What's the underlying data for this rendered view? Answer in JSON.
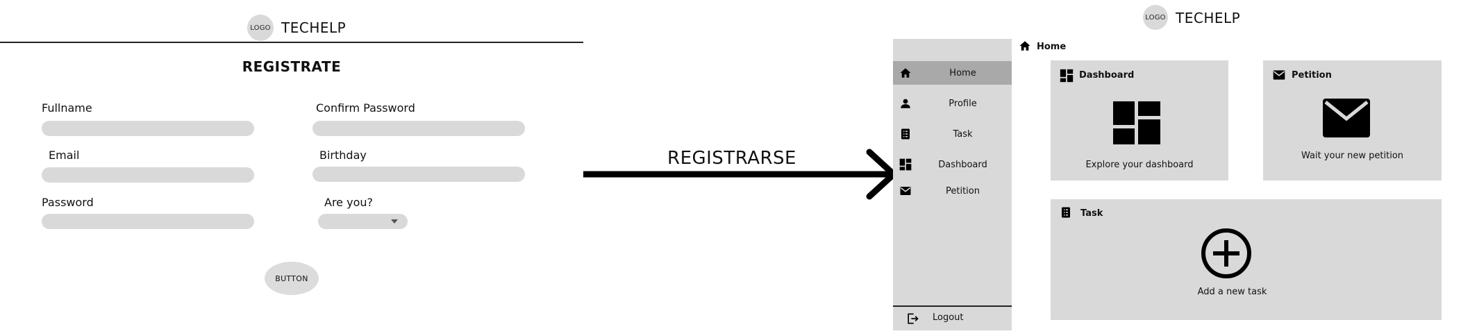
{
  "left": {
    "logo_text": "LOGO",
    "brand": "TECHELP",
    "title": "REGISTRATE",
    "fields": {
      "fullname": "Fullname",
      "confirm_password": "Confirm Password",
      "email": "Email",
      "birthday": "Birthday",
      "password": "Password",
      "are_you": "Are you?"
    },
    "button": "BUTTON"
  },
  "arrow_label": "REGISTRARSE",
  "right": {
    "logo_text": "LOGO",
    "brand": "TECHELP",
    "breadcrumb": "Home",
    "sidebar": {
      "items": [
        {
          "label": "Home",
          "icon": "home-icon",
          "active": true
        },
        {
          "label": "Profile",
          "icon": "person-icon",
          "active": false
        },
        {
          "label": "Task",
          "icon": "task-icon",
          "active": false
        },
        {
          "label": "Dashboard",
          "icon": "dashboard-icon",
          "active": false
        },
        {
          "label": "Petition",
          "icon": "mail-icon",
          "active": false
        }
      ],
      "logout": "Logout"
    },
    "cards": {
      "dashboard": {
        "title": "Dashboard",
        "caption": "Explore your dashboard"
      },
      "petition": {
        "title": "Petition",
        "caption": "Wait your new petition"
      },
      "task": {
        "title": "Task",
        "caption": "Add a new task"
      }
    }
  },
  "colors": {
    "panel": "#d9d9d9",
    "active": "#a9a9a9",
    "ink": "#111111"
  }
}
